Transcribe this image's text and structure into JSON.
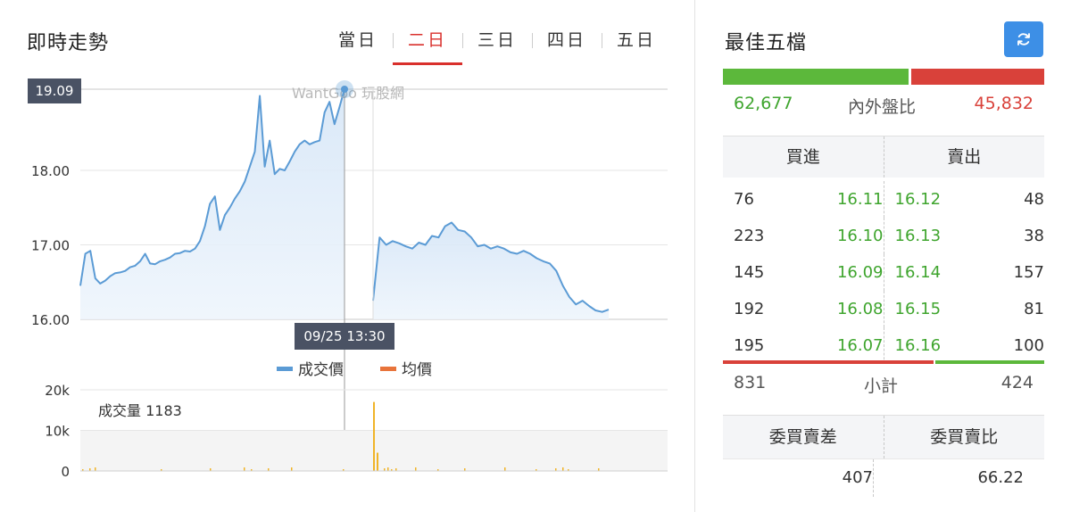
{
  "left": {
    "title": "即時走勢",
    "tabs": [
      {
        "label": "當日",
        "active": false
      },
      {
        "label": "二日",
        "active": true
      },
      {
        "label": "三日",
        "active": false
      },
      {
        "label": "四日",
        "active": false
      },
      {
        "label": "五日",
        "active": false
      }
    ]
  },
  "chart_data": [
    {
      "type": "line",
      "title": "",
      "watermark": "WantGoo 玩股網",
      "yticks": [
        "19.09",
        "18.00",
        "17.00",
        "16.00"
      ],
      "ylim": [
        16.0,
        19.09
      ],
      "grid": true,
      "legend": {
        "placement": "bottom-center",
        "entries": [
          {
            "name": "成交價",
            "color": "#5b9bd5"
          },
          {
            "name": "均價",
            "color": "#e8743b"
          }
        ]
      },
      "crosshair": {
        "price_label": "19.09",
        "time_label": "09/25 13:30"
      },
      "series": [
        {
          "name": "成交價",
          "color": "#5b9bd5",
          "day1": [
            16.45,
            16.88,
            16.92,
            16.55,
            16.48,
            16.52,
            16.58,
            16.62,
            16.63,
            16.65,
            16.7,
            16.72,
            16.78,
            16.88,
            16.75,
            16.74,
            16.78,
            16.8,
            16.83,
            16.88,
            16.89,
            16.92,
            16.91,
            16.95,
            17.05,
            17.25,
            17.55,
            17.65,
            17.2,
            17.4,
            17.5,
            17.62,
            17.72,
            17.85,
            18.05,
            18.25,
            19.0,
            18.05,
            18.4,
            17.95,
            18.02,
            18.0,
            18.12,
            18.25,
            18.35,
            18.4,
            18.35,
            18.38,
            18.4,
            18.78,
            18.92,
            18.62,
            18.85,
            19.09
          ],
          "day2": [
            16.25,
            17.1,
            17.0,
            17.05,
            17.02,
            16.98,
            16.95,
            17.03,
            17.0,
            17.12,
            17.1,
            17.25,
            17.3,
            17.2,
            17.18,
            17.1,
            16.98,
            17.0,
            16.95,
            16.98,
            16.95,
            16.9,
            16.88,
            16.92,
            16.88,
            16.82,
            16.78,
            16.75,
            16.65,
            16.45,
            16.3,
            16.2,
            16.25,
            16.18,
            16.12,
            16.1,
            16.13
          ]
        },
        {
          "name": "均價",
          "color": "#e8743b",
          "day1": [],
          "day2": []
        }
      ]
    },
    {
      "type": "bar",
      "label": "成交量 1183",
      "yticks": [
        "20k",
        "10k",
        "0"
      ],
      "ylim": [
        0,
        20000
      ],
      "color": "#f0b429",
      "highlights": [
        {
          "position": "day2-open",
          "value": 17000
        },
        {
          "position": "day2-second",
          "value": 4500
        }
      ]
    }
  ],
  "right": {
    "title": "最佳五檔",
    "refresh_icon": "refresh-icon",
    "inner_outer_label": "內外盤比",
    "inner_value": "62,677",
    "outer_value": "45,832",
    "inner_fraction": 0.578,
    "buy_header": "買進",
    "sell_header": "賣出",
    "book": [
      {
        "bid_vol": "76",
        "bid_price": "16.11",
        "ask_price": "16.12",
        "ask_vol": "48"
      },
      {
        "bid_vol": "223",
        "bid_price": "16.10",
        "ask_price": "16.13",
        "ask_vol": "38"
      },
      {
        "bid_vol": "145",
        "bid_price": "16.09",
        "ask_price": "16.14",
        "ask_vol": "157"
      },
      {
        "bid_vol": "192",
        "bid_price": "16.08",
        "ask_price": "16.15",
        "ask_vol": "81"
      },
      {
        "bid_vol": "195",
        "bid_price": "16.07",
        "ask_price": "16.16",
        "ask_vol": "100"
      }
    ],
    "subtotal_label": "小計",
    "subtotal_buy": "831",
    "subtotal_sell": "424",
    "committee_diff_label": "委買賣差",
    "committee_ratio_label": "委買賣比",
    "committee_diff": "407",
    "committee_ratio": "66.22"
  },
  "colors": {
    "accent_red": "#d9302c",
    "up_green": "#3fa52e",
    "refresh_blue": "#3d8fe6"
  }
}
